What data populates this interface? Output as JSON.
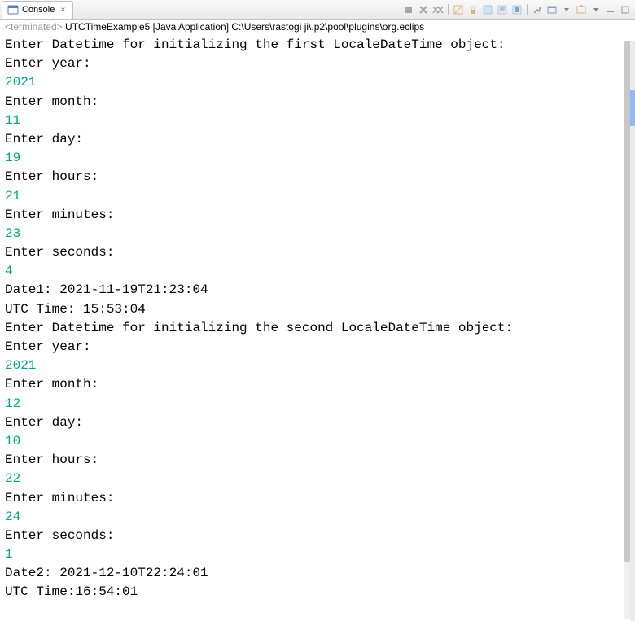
{
  "tab": {
    "label": "Console",
    "close_x": "×"
  },
  "status": {
    "prefix": "<terminated>",
    "text": " UTCTimeExample5 [Java Application] C:\\Users\\rastogi ji\\.p2\\pool\\plugins\\org.eclips"
  },
  "lines": [
    {
      "type": "prompt",
      "text": "Enter Datetime for initializing the first LocaleDateTime object:"
    },
    {
      "type": "prompt",
      "text": "Enter year:"
    },
    {
      "type": "input",
      "text": "2021"
    },
    {
      "type": "prompt",
      "text": "Enter month:"
    },
    {
      "type": "input",
      "text": "11"
    },
    {
      "type": "prompt",
      "text": "Enter day:"
    },
    {
      "type": "input",
      "text": "19"
    },
    {
      "type": "prompt",
      "text": "Enter hours:"
    },
    {
      "type": "input",
      "text": "21"
    },
    {
      "type": "prompt",
      "text": "Enter minutes:"
    },
    {
      "type": "input",
      "text": "23"
    },
    {
      "type": "prompt",
      "text": "Enter seconds:"
    },
    {
      "type": "input",
      "text": "4"
    },
    {
      "type": "prompt",
      "text": "Date1: 2021-11-19T21:23:04"
    },
    {
      "type": "prompt",
      "text": "UTC Time: 15:53:04"
    },
    {
      "type": "prompt",
      "text": "Enter Datetime for initializing the second LocaleDateTime object:"
    },
    {
      "type": "prompt",
      "text": "Enter year:"
    },
    {
      "type": "input",
      "text": "2021"
    },
    {
      "type": "prompt",
      "text": "Enter month:"
    },
    {
      "type": "input",
      "text": "12"
    },
    {
      "type": "prompt",
      "text": "Enter day:"
    },
    {
      "type": "input",
      "text": "10"
    },
    {
      "type": "prompt",
      "text": "Enter hours:"
    },
    {
      "type": "input",
      "text": "22"
    },
    {
      "type": "prompt",
      "text": "Enter minutes:"
    },
    {
      "type": "input",
      "text": "24"
    },
    {
      "type": "prompt",
      "text": "Enter seconds:"
    },
    {
      "type": "input",
      "text": "1"
    },
    {
      "type": "prompt",
      "text": "Date2: 2021-12-10T22:24:01"
    },
    {
      "type": "prompt",
      "text": "UTC Time:16:54:01"
    }
  ]
}
